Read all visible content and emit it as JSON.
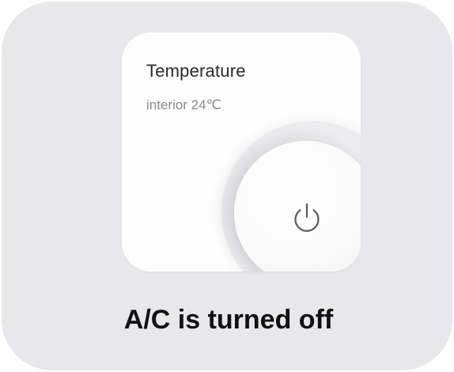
{
  "card": {
    "title": "Temperature",
    "subtitle": "interior 24℃"
  },
  "dial": {
    "icon": "power-icon",
    "state": "off"
  },
  "status": {
    "message": "A/C is turned off"
  },
  "colors": {
    "background": "#e8e8ec",
    "card": "#fdfdfd",
    "icon": "#5a5a60"
  }
}
